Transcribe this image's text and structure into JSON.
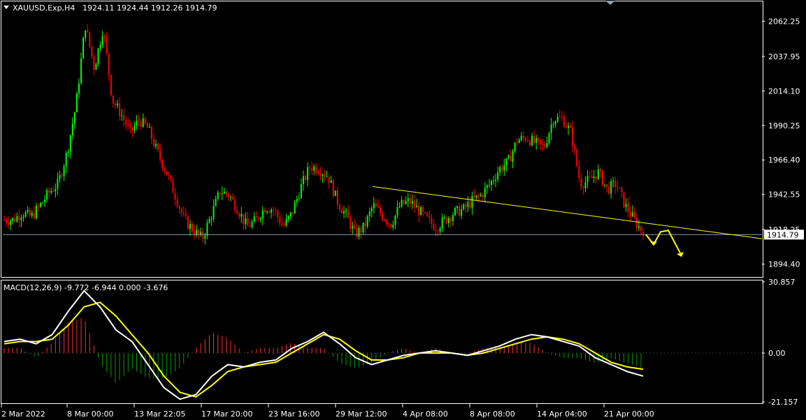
{
  "header": {
    "symbol": "XAUUSD.Exp,H4",
    "ohlc": "1924.11 1924.44 1912.26 1914.79"
  },
  "macd_header": {
    "text": "MACD(12,26,9) -9.772 -6.944 0.000 -3.676"
  },
  "colors": {
    "background": "#000000",
    "bull": "#00ff00",
    "bear": "#ff0000",
    "trendline": "#ffff00",
    "arrows": "#ffff00",
    "price_line": "#8aa0b0",
    "macd_line": "#ffffff",
    "signal_line": "#ffff00",
    "hist_pos": "#ff3030",
    "hist_neg": "#00a000",
    "frame": "#ffffff"
  },
  "price_axis": {
    "ticks": [
      "2062.25",
      "2037.95",
      "2014.10",
      "1990.25",
      "1966.40",
      "1942.55",
      "1918.25",
      "1894.40"
    ],
    "current": "1914.79",
    "ylim": [
      1886.0,
      2075.0
    ]
  },
  "macd_axis": {
    "ticks": [
      "30.857",
      "0.00",
      "-21.157"
    ],
    "ylim": [
      -21.157,
      30.857
    ]
  },
  "x_axis": {
    "labels": [
      "2 Mar 2022",
      "8 Mar 00:00",
      "13 Mar 22:05",
      "17 Mar 20:00",
      "23 Mar 16:00",
      "29 Mar 12:00",
      "4 Apr 08:00",
      "8 Apr 08:00",
      "14 Apr 04:00",
      "21 Apr 00:00"
    ]
  },
  "chart_data": {
    "type": "candlestick",
    "timeframe": "H4",
    "symbol": "XAUUSD.Exp",
    "last_price": 1914.79,
    "approx_close_path": [
      1925,
      1925,
      1930,
      1927,
      1935,
      1944,
      1950,
      1972,
      2005,
      2060,
      2030,
      2058,
      2008,
      1998,
      1985,
      1994,
      1988,
      1972,
      1958,
      1942,
      1925,
      1918,
      1912,
      1928,
      1945,
      1942,
      1932,
      1920,
      1925,
      1934,
      1932,
      1920,
      1930,
      1948,
      1962,
      1960,
      1955,
      1938,
      1928,
      1915,
      1920,
      1935,
      1928,
      1922,
      1935,
      1938,
      1932,
      1925,
      1920,
      1925,
      1930,
      1932,
      1938,
      1942,
      1950,
      1960,
      1965,
      1980,
      1982,
      1978,
      1975,
      1995,
      1995,
      1985,
      1950,
      1952,
      1958,
      1946,
      1950,
      1935,
      1925,
      1916
    ],
    "trendline": {
      "start": 1948.0,
      "end": 1912.0
    },
    "macd": {
      "params": "12,26,9",
      "macd_line": [
        5,
        6,
        4,
        8,
        18,
        27,
        20,
        10,
        5,
        -5,
        -15,
        -20,
        -18,
        -10,
        -5,
        -6,
        -4,
        -3,
        2,
        5,
        9,
        4,
        -2,
        -5,
        -3,
        -1,
        0,
        1,
        0,
        -1,
        1,
        3,
        6,
        8,
        7,
        5,
        3,
        -2,
        -5,
        -8,
        -10
      ],
      "signal_line": [
        4,
        5,
        5,
        6,
        12,
        20,
        22,
        16,
        8,
        0,
        -10,
        -17,
        -19,
        -14,
        -8,
        -6,
        -5,
        -4,
        0,
        4,
        8,
        6,
        1,
        -3,
        -3,
        -2,
        0,
        0,
        0,
        -1,
        0,
        2,
        4,
        6,
        7,
        6,
        4,
        0,
        -4,
        -6,
        -7
      ],
      "histogram_last": -3.676
    }
  }
}
